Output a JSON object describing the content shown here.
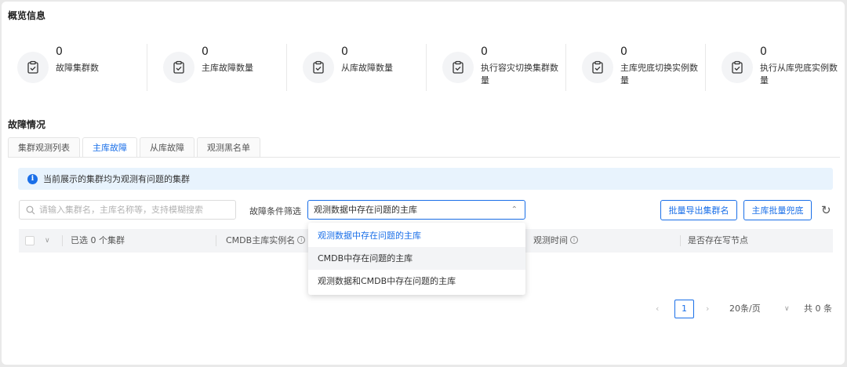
{
  "overview": {
    "title": "概览信息",
    "stats": [
      {
        "value": "0",
        "label": "故障集群数",
        "icon": "clipboard-check-icon"
      },
      {
        "value": "0",
        "label": "主库故障数量",
        "icon": "clipboard-check-icon"
      },
      {
        "value": "0",
        "label": "从库故障数量",
        "icon": "clipboard-check-icon"
      },
      {
        "value": "0",
        "label": "执行容灾切换集群数量",
        "icon": "clipboard-check-icon"
      },
      {
        "value": "0",
        "label": "主库兜底切换实例数量",
        "icon": "clipboard-check-icon"
      },
      {
        "value": "0",
        "label": "执行从库兜底实例数量",
        "icon": "clipboard-check-icon"
      }
    ]
  },
  "fault": {
    "title": "故障情况",
    "tabs": [
      {
        "label": "集群观测列表",
        "active": false
      },
      {
        "label": "主库故障",
        "active": true
      },
      {
        "label": "从库故障",
        "active": false
      },
      {
        "label": "观测黑名单",
        "active": false
      }
    ],
    "alert": "当前展示的集群均为观测有问题的集群",
    "search_placeholder": "请输入集群名，主库名称等，支持模糊搜索",
    "filter_label": "故障条件筛选",
    "filter_value": "观测数据中存在问题的主库",
    "filter_options": [
      {
        "label": "观测数据中存在问题的主库",
        "state": "selected"
      },
      {
        "label": "CMDB中存在问题的主库",
        "state": "hover"
      },
      {
        "label": "观测数据和CMDB中存在问题的主库",
        "state": "normal"
      }
    ],
    "buttons": {
      "export": "批量导出集群名",
      "fallback": "主库批量兜底"
    },
    "table": {
      "selected_text": "已选 0 个集群",
      "col_cmdb": "CMDB主库实例名",
      "col_time": "观测时间",
      "col_write": "是否存在写节点"
    },
    "pagination": {
      "current_page": "1",
      "page_size": "20条/页",
      "total": "共 0 条"
    }
  },
  "colors": {
    "accent": "#1a6fe8",
    "alert_bg": "#e8f3fd",
    "header_bg": "#f3f4f6"
  }
}
